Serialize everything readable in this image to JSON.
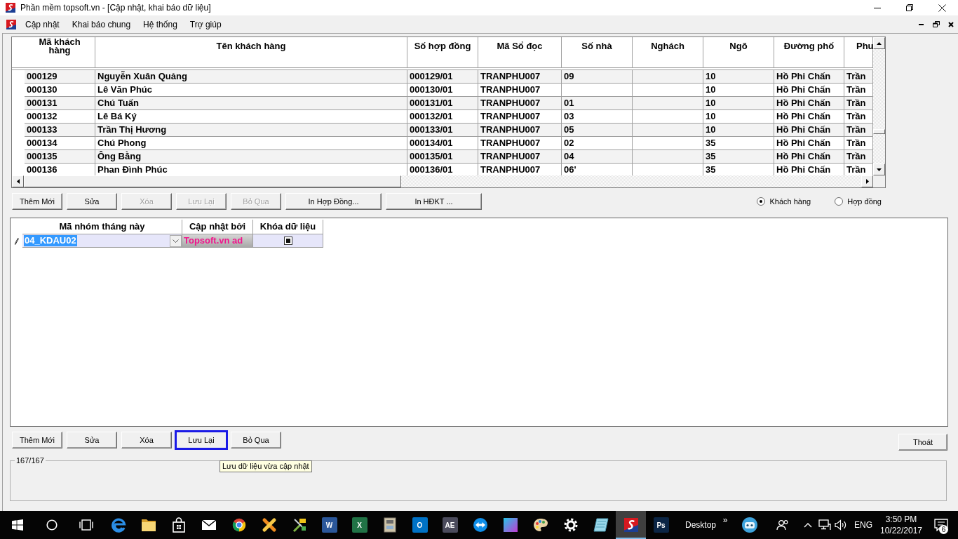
{
  "window": {
    "title": "Phần mềm topsoft.vn - [Cập nhật, khai báo dữ liệu]"
  },
  "menu": [
    "Cập nhật",
    "Khai báo chung",
    "Hệ thống",
    "Trợ giúp"
  ],
  "customer_table": {
    "columns": [
      "Mã khách hàng",
      "Tên khách hàng",
      "Số hợp đồng",
      "Mã Sổ đọc",
      "Số nhà",
      "Nghách",
      "Ngõ",
      "Đường phố",
      "Phu"
    ],
    "rows": [
      [
        "000129",
        "Nguyễn Xuân Quảng",
        "000129/01",
        "TRANPHU007",
        "09",
        null,
        "10",
        "Hồ Phi Chấn",
        "Trần"
      ],
      [
        "000130",
        "Lê Văn Phúc",
        "000130/01",
        "TRANPHU007",
        null,
        null,
        "10",
        "Hồ Phi Chấn",
        "Trần"
      ],
      [
        "000131",
        "Chú Tuấn",
        "000131/01",
        "TRANPHU007",
        "01",
        null,
        "10",
        "Hồ Phi Chấn",
        "Trần"
      ],
      [
        "000132",
        "Lê Bá Ký",
        "000132/01",
        "TRANPHU007",
        "03",
        null,
        "10",
        "Hồ Phi Chấn",
        "Trần"
      ],
      [
        "000133",
        "Trần Thị Hương",
        "000133/01",
        "TRANPHU007",
        "05",
        null,
        "10",
        "Hồ Phi Chấn",
        "Trần"
      ],
      [
        "000134",
        "Chú Phong",
        "000134/01",
        "TRANPHU007",
        "02",
        null,
        "35",
        "Hồ Phi Chấn",
        "Trần"
      ],
      [
        "000135",
        "Ông Bằng",
        "000135/01",
        "TRANPHU007",
        "04",
        null,
        "35",
        "Hồ Phi Chấn",
        "Trần"
      ],
      [
        "000136",
        "Phan Đình Phúc",
        "000136/01",
        "TRANPHU007",
        "06'",
        null,
        "35",
        "Hồ Phi Chấn",
        "Trần"
      ]
    ]
  },
  "record_buttons": [
    {
      "label": "Thêm Mới",
      "kind": "action",
      "disabled": false
    },
    {
      "label": "Sửa",
      "kind": "action",
      "disabled": false
    },
    {
      "label": "Xóa",
      "kind": "action",
      "disabled": true
    },
    {
      "label": "Lưu Lại",
      "kind": "action",
      "disabled": true
    },
    {
      "label": "Bỏ Qua",
      "kind": "action",
      "disabled": true
    },
    {
      "label": "In Hợp Đồng...",
      "kind": "print",
      "disabled": false
    },
    {
      "label": "In HĐKT ...",
      "kind": "print",
      "disabled": false
    }
  ],
  "view_options": [
    {
      "label": "Khách hàng",
      "selected": true
    },
    {
      "label": "Hợp đồng",
      "selected": false
    }
  ],
  "month_group_table": {
    "columns": [
      "Mã nhóm tháng này",
      "Cập nhật bởi",
      "Khóa dữ liệu"
    ],
    "rows": [
      {
        "editing": true,
        "group_code": "04_KDAU02",
        "group_code_selected": true,
        "updated_by": "Topsoft.vn ad",
        "locked": true
      }
    ]
  },
  "group_buttons": [
    {
      "label": "Thêm Mới",
      "disabled": false,
      "focused": false
    },
    {
      "label": "Sửa",
      "disabled": false,
      "focused": false
    },
    {
      "label": "Xóa",
      "disabled": false,
      "focused": false
    },
    {
      "label": "Lưu Lại",
      "disabled": false,
      "focused": true
    },
    {
      "label": "Bỏ Qua",
      "disabled": false,
      "focused": false
    }
  ],
  "exit_button": {
    "label": "Thoát"
  },
  "tooltip": "Lưu dữ liệu vừa cập nhật",
  "record_count": "167/167",
  "taskbar": {
    "items": [
      {
        "kind": "start",
        "selected": false
      },
      {
        "kind": "search",
        "selected": false
      },
      {
        "kind": "task-view",
        "selected": false
      },
      {
        "kind": "edge",
        "selected": false
      },
      {
        "kind": "folder",
        "selected": false
      },
      {
        "kind": "store",
        "selected": false
      },
      {
        "kind": "mail",
        "selected": false
      },
      {
        "kind": "chrome",
        "selected": false
      },
      {
        "kind": "ribbon",
        "selected": false
      },
      {
        "kind": "tools",
        "selected": false
      },
      {
        "kind": "tile",
        "letter": "W",
        "color": "#2b579a",
        "selected": false
      },
      {
        "kind": "tile",
        "letter": "X",
        "color": "#217346",
        "selected": false
      },
      {
        "kind": "cabinet",
        "selected": false
      },
      {
        "kind": "tile",
        "letter": "O",
        "color": "#0072c6",
        "selected": false
      },
      {
        "kind": "tile",
        "letter": "AE",
        "color": "#4b4b5c",
        "selected": false
      },
      {
        "kind": "arrows",
        "selected": false
      },
      {
        "kind": "gradient",
        "selected": false
      },
      {
        "kind": "palette",
        "selected": false
      },
      {
        "kind": "gear",
        "selected": false
      },
      {
        "kind": "notebook",
        "selected": false
      },
      {
        "kind": "logo",
        "selected": true
      },
      {
        "kind": "tile",
        "letter": "Ps",
        "color": "#0b2545",
        "selected": false
      }
    ],
    "toolbar": {
      "label": "Desktop",
      "chevron": "»"
    },
    "tray": {
      "icons": [
        {
          "kind": "robot"
        },
        {
          "kind": "people"
        },
        {
          "kind": "caret"
        },
        {
          "kind": "network"
        },
        {
          "kind": "volume"
        }
      ],
      "language": "ENG",
      "time": "3:50 PM",
      "date": "10/22/2017",
      "notification_count": "6"
    }
  }
}
